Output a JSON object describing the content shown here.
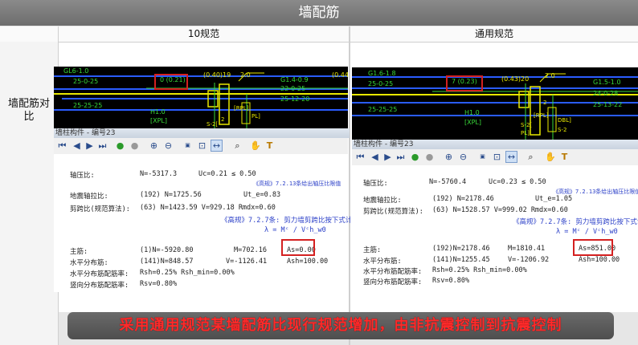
{
  "title": "墙配筋",
  "col_left": "10规范",
  "col_right": "通用规范",
  "row_label": "墙配筋对比",
  "banner": "采用通用规范某墙配筋比现行规范增加，由非抗震控制到抗震控制",
  "left": {
    "cad_texts": [
      "GL6-1.0",
      "25-0-25",
      "0 (0.21)",
      "(0.40)19",
      "2.0",
      "G1.4-0.9",
      "22-0-25",
      "25-12-20",
      "25-25-25",
      "(0.44",
      "H1.0",
      "[XPL]",
      "[RPL]",
      "2",
      "S-2[",
      "PL]",
      "DBL]",
      "S-2"
    ],
    "window_title": "墙柱构件 - 编号23",
    "doc": {
      "l1a": "轴压比:",
      "l1b": "N=-5317.3",
      "l1c": "Uc=0.21 ≤ 0.50",
      "note1": "《高规》7.2.13条给出轴压比限值",
      "l2a": "地震轴拉比:",
      "l2b": "(192) N=1725.56",
      "l2c": "Ut_e=0.83",
      "l3a": "剪跨比(规范算法):",
      "l3b": "(63) N=1423.59 V=929.18 Rmdx=0.60",
      "note2": "《高规》7.2.7条: 剪力墙剪跨比按下式计算",
      "formula": "λ = Mᶜ / Vᶜh_w0",
      "l4a": "主筋:",
      "l4b": "(1)N=-5920.80",
      "l4c": "M=702.16",
      "l4d": "As=0.00",
      "l5a": "水平分布筋:",
      "l5b": "(141)N=848.57",
      "l5c": "V=-1126.41",
      "l5d": "Ash=100.00",
      "l6a": "水平分布筋配筋率:",
      "l6b": "Rsh=0.25% Rsh_min=0.00%",
      "l7a": "竖向分布筋配筋率:",
      "l7b": "Rsv=0.80%"
    }
  },
  "right": {
    "cad_texts": [
      "G1.6-1.8",
      "25-0-25",
      "25-25-25",
      "7 (0.23)",
      "(0.43)20",
      "2.0",
      "G1.5-1.0",
      "24-0-28",
      "25-13-22",
      "H1.0",
      "[XPL]",
      "[RPL]",
      "2",
      "S-2[",
      "PL]",
      "DBL]",
      "S-2"
    ],
    "window_title": "墙柱构件 - 编号23",
    "doc": {
      "l1a": "轴压比:",
      "l1b": "N=-5760.4",
      "l1c": "Uc=0.23 ≤ 0.50",
      "note1": "《高规》7.2.13条给出轴压比限值",
      "l2a": "地震轴拉比:",
      "l2b": "(192) N=2178.46",
      "l2c": "Ut_e=1.05",
      "l3a": "剪跨比(规范算法):",
      "l3b": "(63) N=1528.57 V=999.02 Rmdx=0.60",
      "note2": "《高规》7.2.7条: 剪力墙剪跨比按下式计算",
      "formula": "λ = Mᶜ / Vᶜh_w0",
      "l4a": "主筋:",
      "l4b": "(192)N=2178.46",
      "l4c": "M=1810.41",
      "l4d": "As=851.00",
      "l5a": "水平分布筋:",
      "l5b": "(141)N=1255.45",
      "l5c": "V=-1206.92",
      "l5d": "Ash=100.00",
      "l6a": "水平分布筋配筋率:",
      "l6b": "Rsh=0.25% Rsh_min=0.00%",
      "l7a": "竖向分布筋配筋率:",
      "l7b": "Rsv=0.80%"
    }
  },
  "colors": {
    "accent_red": "#d42020",
    "banner_text": "#ff2a2a",
    "cad_bg": "#000000",
    "cad_yellow": "#e8e800",
    "cad_green": "#38d838",
    "cad_blue": "#2a5cff"
  },
  "icons": [
    "first-icon",
    "prev-icon",
    "next-icon",
    "last-icon",
    "play-icon",
    "stop-icon",
    "zoom-in-icon",
    "zoom-out-icon",
    "zoom-100-icon",
    "fit-icon",
    "fit-width-icon",
    "find-icon",
    "hand-icon",
    "text-tool-icon"
  ]
}
